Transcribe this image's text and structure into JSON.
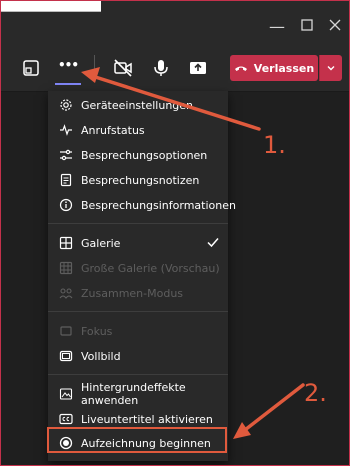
{
  "toolbar": {
    "leave_label": "Verlassen",
    "more_label": "•••"
  },
  "menu": {
    "items": [
      {
        "label": "Geräteeinstellungen",
        "icon": "gear-icon",
        "enabled": true
      },
      {
        "label": "Anrufstatus",
        "icon": "pulse-icon",
        "enabled": true
      },
      {
        "label": "Besprechungsoptionen",
        "icon": "sliders-icon",
        "enabled": true
      },
      {
        "label": "Besprechungsnotizen",
        "icon": "notes-icon",
        "enabled": true
      },
      {
        "label": "Besprechungsinformationen",
        "icon": "info-icon",
        "enabled": true
      },
      {
        "label": "Galerie",
        "icon": "grid-icon",
        "enabled": true,
        "checked": true
      },
      {
        "label": "Große Galerie (Vorschau)",
        "icon": "large-grid-icon",
        "enabled": false
      },
      {
        "label": "Zusammen-Modus",
        "icon": "together-icon",
        "enabled": false
      },
      {
        "label": "Fokus",
        "icon": "focus-icon",
        "enabled": false
      },
      {
        "label": "Vollbild",
        "icon": "fullscreen-icon",
        "enabled": true
      },
      {
        "label": "Hintergrundeffekte anwenden",
        "icon": "background-effects-icon",
        "enabled": true
      },
      {
        "label": "Liveuntertitel aktivieren",
        "icon": "captions-icon",
        "enabled": true
      },
      {
        "label": "Aufzeichnung beginnen",
        "icon": "record-icon",
        "enabled": true
      }
    ]
  },
  "annotations": {
    "step1": "1.",
    "step2": "2."
  },
  "colors": {
    "accent": "#c4314b",
    "annotation": "#e05a3d",
    "underline": "#7f85f5",
    "background": "#1f1f1f",
    "menu_bg": "#292929",
    "disabled_text": "#5e5e5e"
  }
}
